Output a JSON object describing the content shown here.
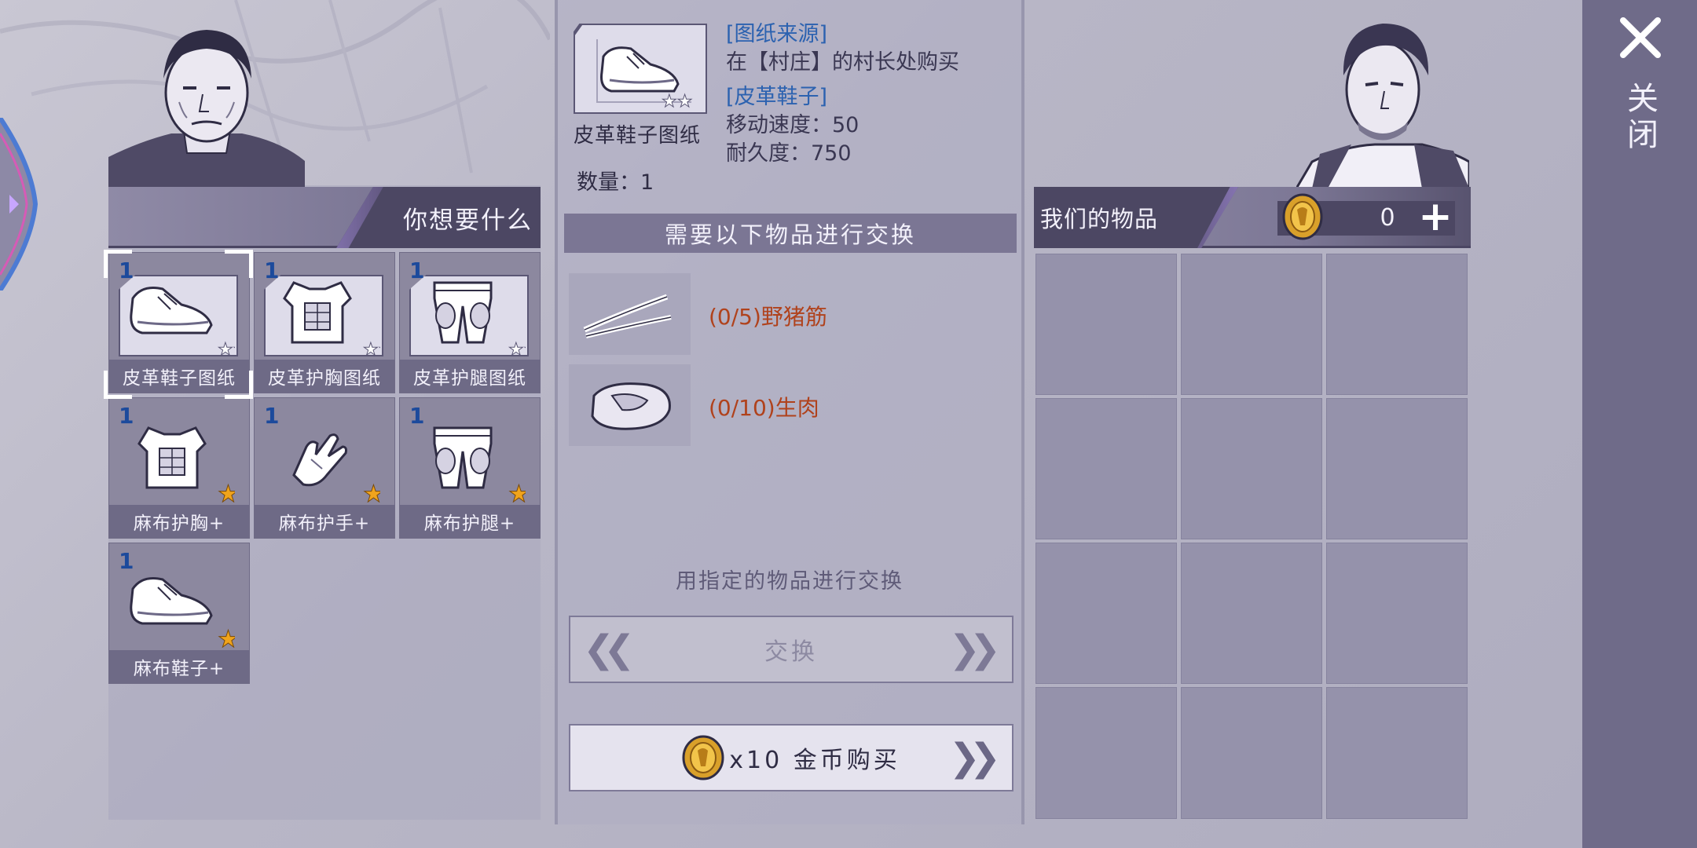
{
  "left": {
    "header": "你想要什么",
    "items": [
      {
        "qty": "1",
        "name": "皮革鞋子图纸",
        "stars": 2,
        "kind": "blueprint",
        "icon": "boots-icon",
        "selected": true
      },
      {
        "qty": "1",
        "name": "皮革护胸图纸",
        "stars": 2,
        "kind": "blueprint",
        "icon": "chest-armor-icon",
        "selected": false
      },
      {
        "qty": "1",
        "name": "皮革护腿图纸",
        "stars": 2,
        "kind": "blueprint",
        "icon": "leg-armor-icon",
        "selected": false
      },
      {
        "qty": "1",
        "name": "麻布护胸+",
        "stars": 1,
        "kind": "item",
        "icon": "chest-armor-icon",
        "selected": false
      },
      {
        "qty": "1",
        "name": "麻布护手+",
        "stars": 1,
        "kind": "item",
        "icon": "gloves-icon",
        "selected": false
      },
      {
        "qty": "1",
        "name": "麻布护腿+",
        "stars": 1,
        "kind": "item",
        "icon": "leg-armor-icon",
        "selected": false
      },
      {
        "qty": "1",
        "name": "麻布鞋子+",
        "stars": 1,
        "kind": "item",
        "icon": "boots-icon",
        "selected": false
      }
    ]
  },
  "detail": {
    "blueprint_name": "皮革鞋子图纸",
    "quantity": "数量：1",
    "source_title": "[图纸来源]",
    "source_text": "在【村庄】的村长处购买",
    "item_title": "[皮革鞋子]",
    "stat_speed": "移动速度：50",
    "stat_durability": "耐久度：750"
  },
  "exchange": {
    "header": "需要以下物品进行交换",
    "requirements": [
      {
        "text": "(0/5)野猪筋",
        "icon": "sinew-icon"
      },
      {
        "text": "(0/10)生肉",
        "icon": "raw-meat-icon"
      }
    ],
    "hint": "用指定的物品进行交换",
    "exchange_label": "交换",
    "buy_label": "x10 金币购买"
  },
  "right": {
    "header": "我们的物品",
    "gold": "0",
    "inventory_slots": 15
  },
  "close_label": "关闭",
  "colors": {
    "qty_blue": "#1c4a9c",
    "require_red": "#b0421c",
    "info_blue": "#2c62b0",
    "panel_dark": "#4c4763",
    "star_gold": "#f0a41c"
  }
}
